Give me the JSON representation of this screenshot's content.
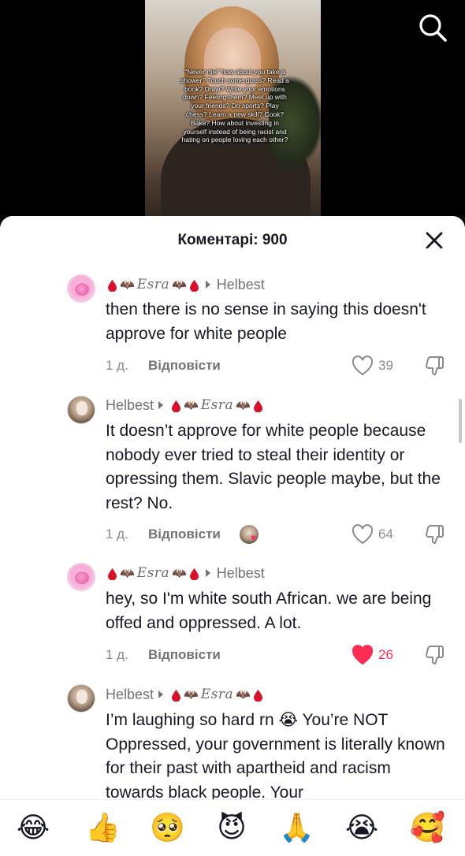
{
  "video": {
    "overlay_text": "\"Never mix\" how about you take a shower? Touch some grass? Read a book? Draw? Write your emotions down? Feeling them? Meet up with your friends? Do sports? Play chess? Learn a new skill? Cook? Bake? How about investing in yourself instead of being racist and hating on people loving each other?"
  },
  "top_bar": {
    "search_icon": "search-icon"
  },
  "comments_sheet": {
    "title": "Коментарі: 900",
    "close_icon": "close-icon",
    "reply_label": "Відповісти",
    "comments": [
      {
        "author": "Esra",
        "reply_to": "Helbest",
        "text": "then there is no sense in saying this doesn't approve for white people",
        "time": "1 д.",
        "likes": "39",
        "liked": false,
        "creator_liked": false
      },
      {
        "author": "Helbest",
        "reply_to": "Esra",
        "text": "It doesn’t approve for white people because nobody ever tried to steal their identity or opressing them. Slavic people maybe, but the rest? No.",
        "time": "1 д.",
        "likes": "64",
        "liked": false,
        "creator_liked": true
      },
      {
        "author": "Esra",
        "reply_to": "Helbest",
        "text": "hey, so I'm white south African. we are being offed and oppressed. A lot.",
        "time": "1 д.",
        "likes": "26",
        "liked": true,
        "creator_liked": false
      },
      {
        "author": "Helbest",
        "reply_to": "Esra",
        "text": "I’m laughing so hard rn 😭 You’re NOT Oppressed, your government is literally known for their past with apartheid and racism towards black people. Your",
        "time": "",
        "likes": "",
        "liked": false,
        "creator_liked": false
      }
    ]
  },
  "emoji_bar": {
    "emojis": [
      "😂",
      "👍",
      "🥺",
      "😈",
      "🙏",
      "😭",
      "🥰"
    ]
  },
  "colors": {
    "accent_like": "#fe2c55",
    "text_primary": "#161823",
    "text_secondary": "#8a8b91"
  }
}
